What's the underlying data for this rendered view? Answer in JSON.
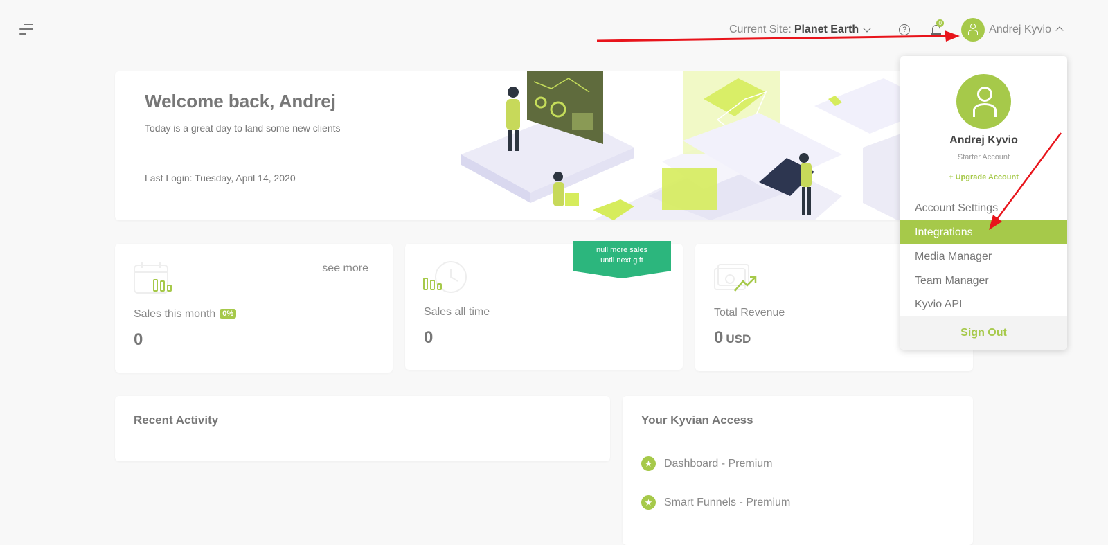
{
  "header": {
    "site_prefix": "Current Site:",
    "site_name": "Planet Earth",
    "notification_count": "0",
    "user_name": "Andrej Kyvio"
  },
  "welcome": {
    "title": "Welcome back, Andrej",
    "subtitle": "Today is a great day to land some new clients",
    "last_login": "Last Login: Tuesday, April 14, 2020"
  },
  "stats": {
    "sales_month": {
      "label": "Sales this month",
      "badge": "0%",
      "value": "0",
      "link": "see more"
    },
    "sales_all": {
      "label": "Sales all time",
      "value": "0",
      "ribbon_line1": "null more sales",
      "ribbon_line2": "until next gift"
    },
    "revenue": {
      "label": "Total Revenue",
      "value": "0",
      "unit": "USD"
    }
  },
  "recent_activity": {
    "title": "Recent Activity"
  },
  "access": {
    "title": "Your Kyvian Access",
    "items": [
      "Dashboard - Premium",
      "Smart Funnels - Premium"
    ]
  },
  "dropdown": {
    "name": "Andrej Kyvio",
    "plan": "Starter Account",
    "upgrade": "+ Upgrade Account",
    "items": [
      "Account Settings",
      "Integrations",
      "Media Manager",
      "Team Manager",
      "Kyvio API"
    ],
    "active_item": "Integrations",
    "sign_out": "Sign Out"
  },
  "colors": {
    "accent": "#a6c94a",
    "ribbon": "#2cb67d",
    "annotation_arrow": "#e8141b",
    "background": "#f8f8f8"
  },
  "icons": [
    "menu-icon",
    "chevron-down-icon",
    "help-icon",
    "bell-icon",
    "user-icon",
    "chevron-up-icon",
    "calendar-chart-icon",
    "history-chart-icon",
    "money-growth-icon",
    "star-icon"
  ]
}
